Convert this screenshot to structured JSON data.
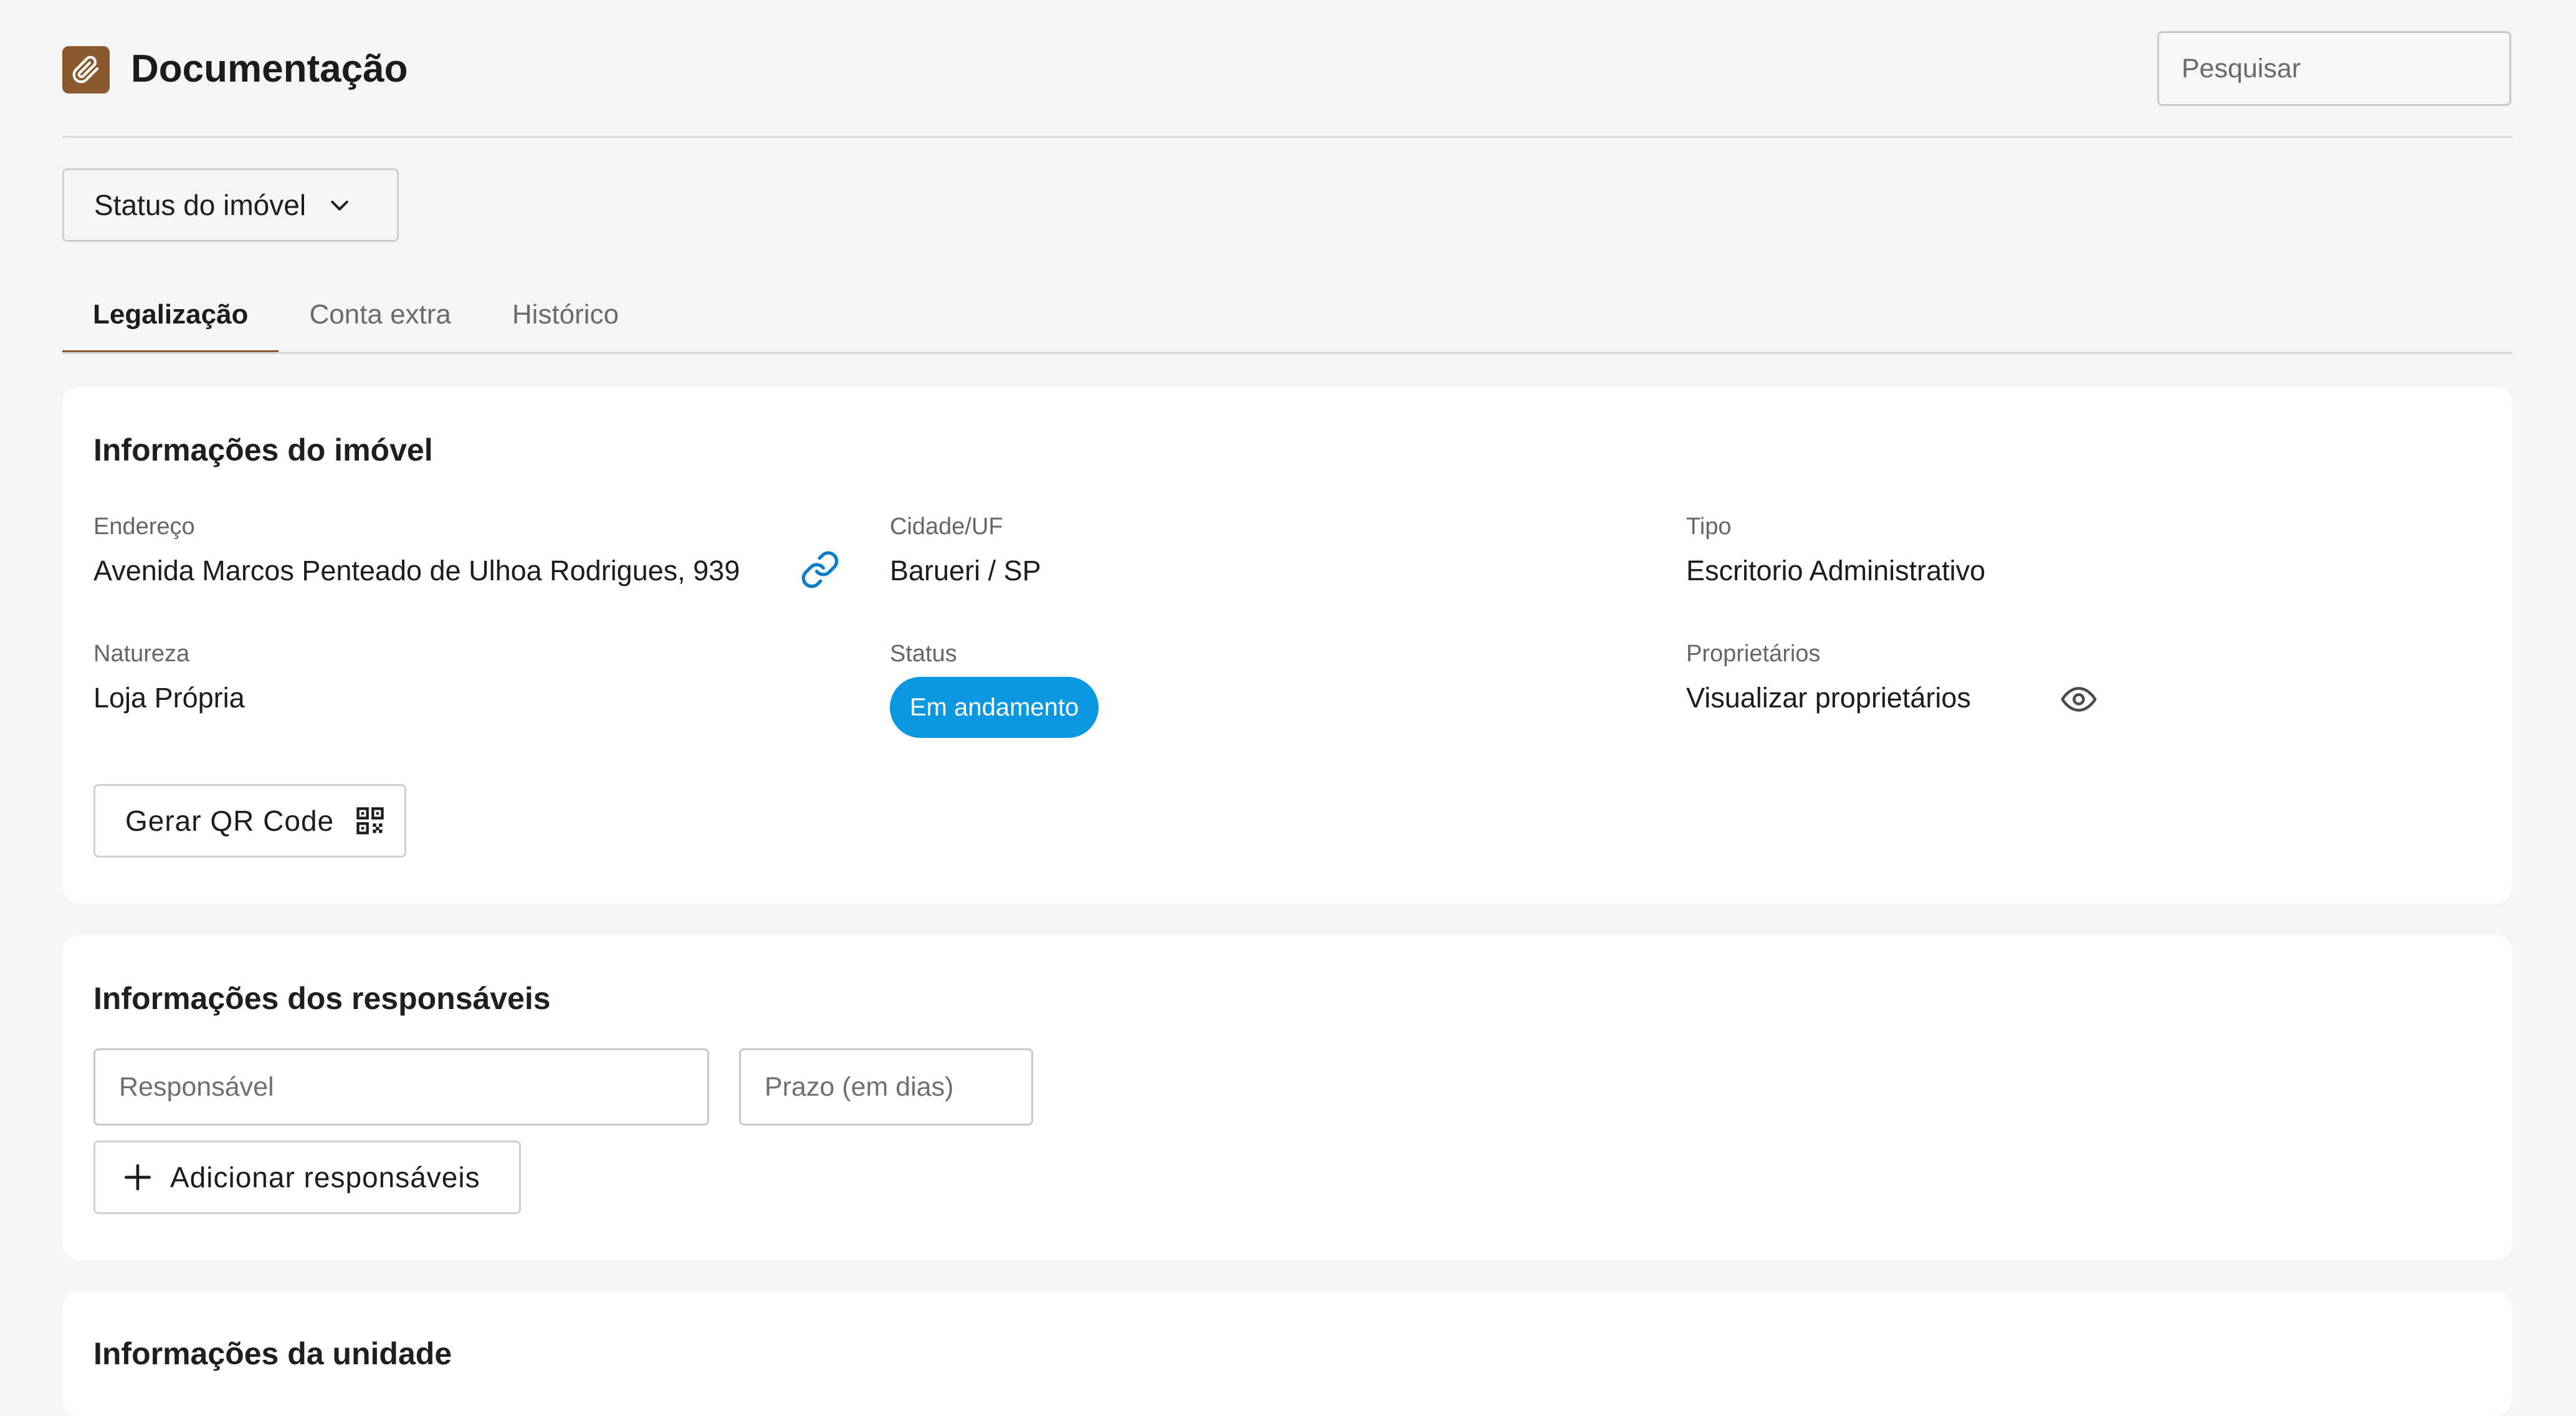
{
  "header": {
    "title": "Documentação",
    "logo_icon": "paperclip-icon",
    "search_placeholder": "Pesquisar"
  },
  "status_dropdown": {
    "label": "Status do imóvel"
  },
  "tabs": [
    {
      "label": "Legalização",
      "active": true
    },
    {
      "label": "Conta extra",
      "active": false
    },
    {
      "label": "Histórico",
      "active": false
    }
  ],
  "property_info": {
    "title": "Informações do imóvel",
    "endereco": {
      "label": "Endereço",
      "value": "Avenida Marcos Penteado de Ulhoa Rodrigues, 939"
    },
    "cidade": {
      "label": "Cidade/UF",
      "value": "Barueri / SP"
    },
    "tipo": {
      "label": "Tipo",
      "value": "Escritorio Administrativo"
    },
    "natureza": {
      "label": "Natureza",
      "value": "Loja Própria"
    },
    "status": {
      "label": "Status",
      "value": "Em andamento"
    },
    "proprietarios": {
      "label": "Proprietários",
      "link": "Visualizar proprietários"
    },
    "qr_button": "Gerar QR Code"
  },
  "responsaveis": {
    "title": "Informações dos responsáveis",
    "responsavel_placeholder": "Responsável",
    "prazo_placeholder": "Prazo (em dias)",
    "add_button": "Adicionar responsáveis"
  },
  "unidade": {
    "title": "Informações da unidade"
  },
  "colors": {
    "brand": "#8a5a2f",
    "status_badge": "#0a98e0",
    "link_icon": "#0a7fc8",
    "background": "#f5f5f5"
  }
}
